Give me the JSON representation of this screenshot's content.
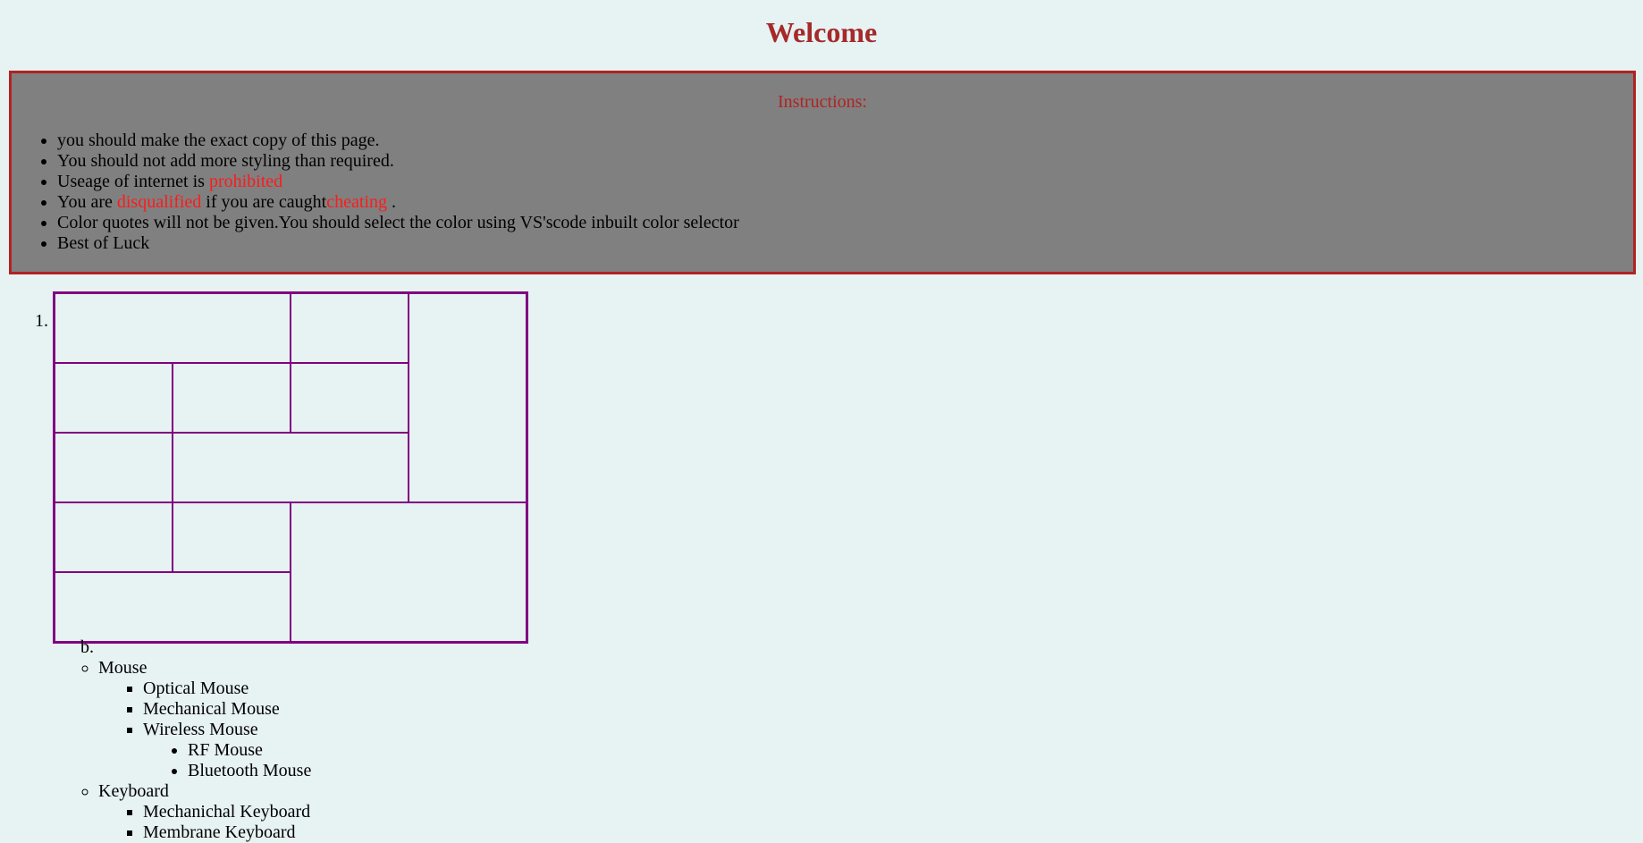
{
  "page": {
    "title": "Welcome"
  },
  "instructions": {
    "heading": "Instructions:",
    "items": [
      {
        "text": "you should make the exact copy of this page."
      },
      {
        "text": "You should not add more styling than required."
      },
      {
        "before": "Useage of internet is ",
        "red": "prohibited"
      },
      {
        "before": "You are ",
        "red1": "disqualified",
        "middle": " if you are caught",
        "red2": "cheating",
        "after": " ."
      },
      {
        "text": "Color quotes will not be given.You should select the color using VS'scode inbuilt color selector"
      },
      {
        "text": "Best of Luck"
      }
    ]
  },
  "ordered_list": {
    "marker1": "1.",
    "marker2": "b."
  },
  "devices": {
    "mouse": {
      "label": "Mouse",
      "items": [
        "Optical Mouse",
        "Mechanical Mouse",
        "Wireless Mouse"
      ],
      "wireless": [
        "RF Mouse",
        "Bluetooth Mouse"
      ]
    },
    "keyboard": {
      "label": "Keyboard",
      "items": [
        "Mechanichal Keyboard",
        "Membrane Keyboard"
      ]
    }
  },
  "colors": {
    "background": "#e7f2f3",
    "title": "#a52a2a",
    "box_background": "#808080",
    "box_border": "#b22222",
    "highlight": "#ff1a1a",
    "table_border": "#800080"
  }
}
